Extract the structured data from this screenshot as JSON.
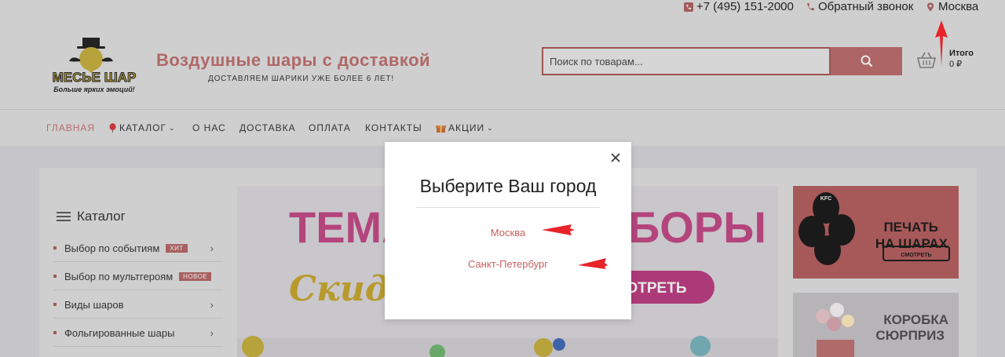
{
  "topbar": {
    "phone": "+7 (495) 151-2000",
    "callback": "Обратный звонок",
    "city": "Москва"
  },
  "header": {
    "logo_text": "МЕСЬЕ ШАР",
    "logo_tagline": "Больше ярких эмоций!",
    "title": "Воздушные шары с доставкой",
    "subtitle": "ДОСТАВЛЯЕМ ШАРИКИ УЖЕ БОЛЕЕ 6 ЛЕТ!",
    "search_placeholder": "Поиск по товарам...",
    "cart_label": "Итого",
    "cart_total": "0 ₽"
  },
  "nav": {
    "items": [
      {
        "label": "ГЛАВНАЯ"
      },
      {
        "label": "КАТАЛОГ"
      },
      {
        "label": "О НАС"
      },
      {
        "label": "ДОСТАВКА"
      },
      {
        "label": "ОПЛАТА"
      },
      {
        "label": "КОНТАКТЫ"
      },
      {
        "label": "АКЦИИ"
      }
    ]
  },
  "catalog": {
    "title": "Каталог",
    "items": [
      {
        "label": "Выбор по событиям",
        "badge": "ХИТ"
      },
      {
        "label": "Выбор по мультгероям",
        "badge": "НОВОЕ"
      },
      {
        "label": "Виды шаров",
        "badge": ""
      },
      {
        "label": "Фольгированные шары",
        "badge": ""
      }
    ]
  },
  "banner": {
    "headline_left": "ТЕМАТ",
    "headline_right": "БОРЫ",
    "script": "Скидк",
    "button": "ОТРЕТЬ"
  },
  "side_banners": {
    "first": {
      "line1": "ПЕЧАТЬ",
      "line2": "НА ШАРАХ",
      "button": "СМОТРЕТЬ",
      "balloon_text": "KFC"
    },
    "second": {
      "line1": "КОРОБКА",
      "line2": "СЮРПРИЗ"
    }
  },
  "modal": {
    "title": "Выберите Ваш город",
    "cities": [
      "Москва",
      "Санкт-Петербург"
    ]
  },
  "colors": {
    "accent": "#c95f5f",
    "annotation": "#e8232a"
  }
}
